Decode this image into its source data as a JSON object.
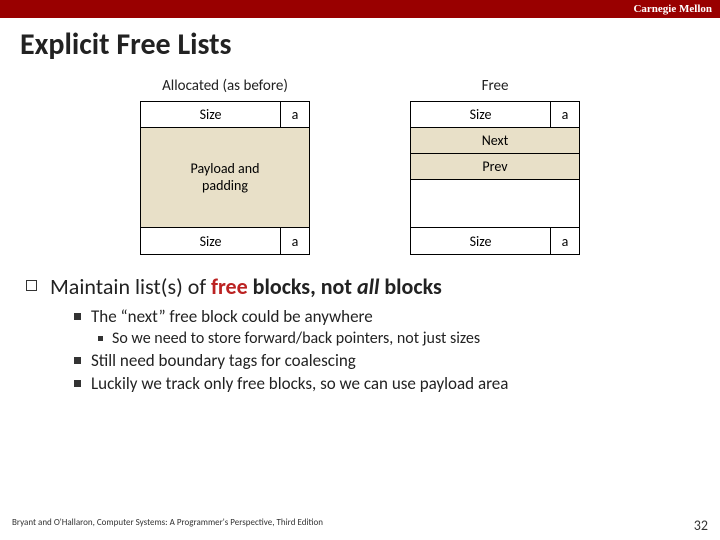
{
  "header": {
    "brand": "Carnegie Mellon"
  },
  "title": "Explicit Free Lists",
  "diagrams": {
    "allocated": {
      "label": "Allocated (as before)",
      "top_size": "Size",
      "top_a": "a",
      "payload": "Payload and\npadding",
      "bot_size": "Size",
      "bot_a": "a"
    },
    "free": {
      "label": "Free",
      "top_size": "Size",
      "top_a": "a",
      "next": "Next",
      "prev": "Prev",
      "bot_size": "Size",
      "bot_a": "a"
    }
  },
  "bullet": {
    "pre": "Maintain list(s) of ",
    "emph": "free",
    "mid": " blocks, not ",
    "ital": "all",
    "post": " blocks"
  },
  "subs": {
    "s1": "The “next” free block could be anywhere",
    "s1a": "So we need to store forward/back pointers, not just sizes",
    "s2": "Still need boundary tags for coalescing",
    "s3": "Luckily we track only free blocks, so we can use payload area"
  },
  "footer": {
    "cite": "Bryant and O'Hallaron, Computer Systems: A Programmer's Perspective, Third Edition",
    "page": "32"
  }
}
